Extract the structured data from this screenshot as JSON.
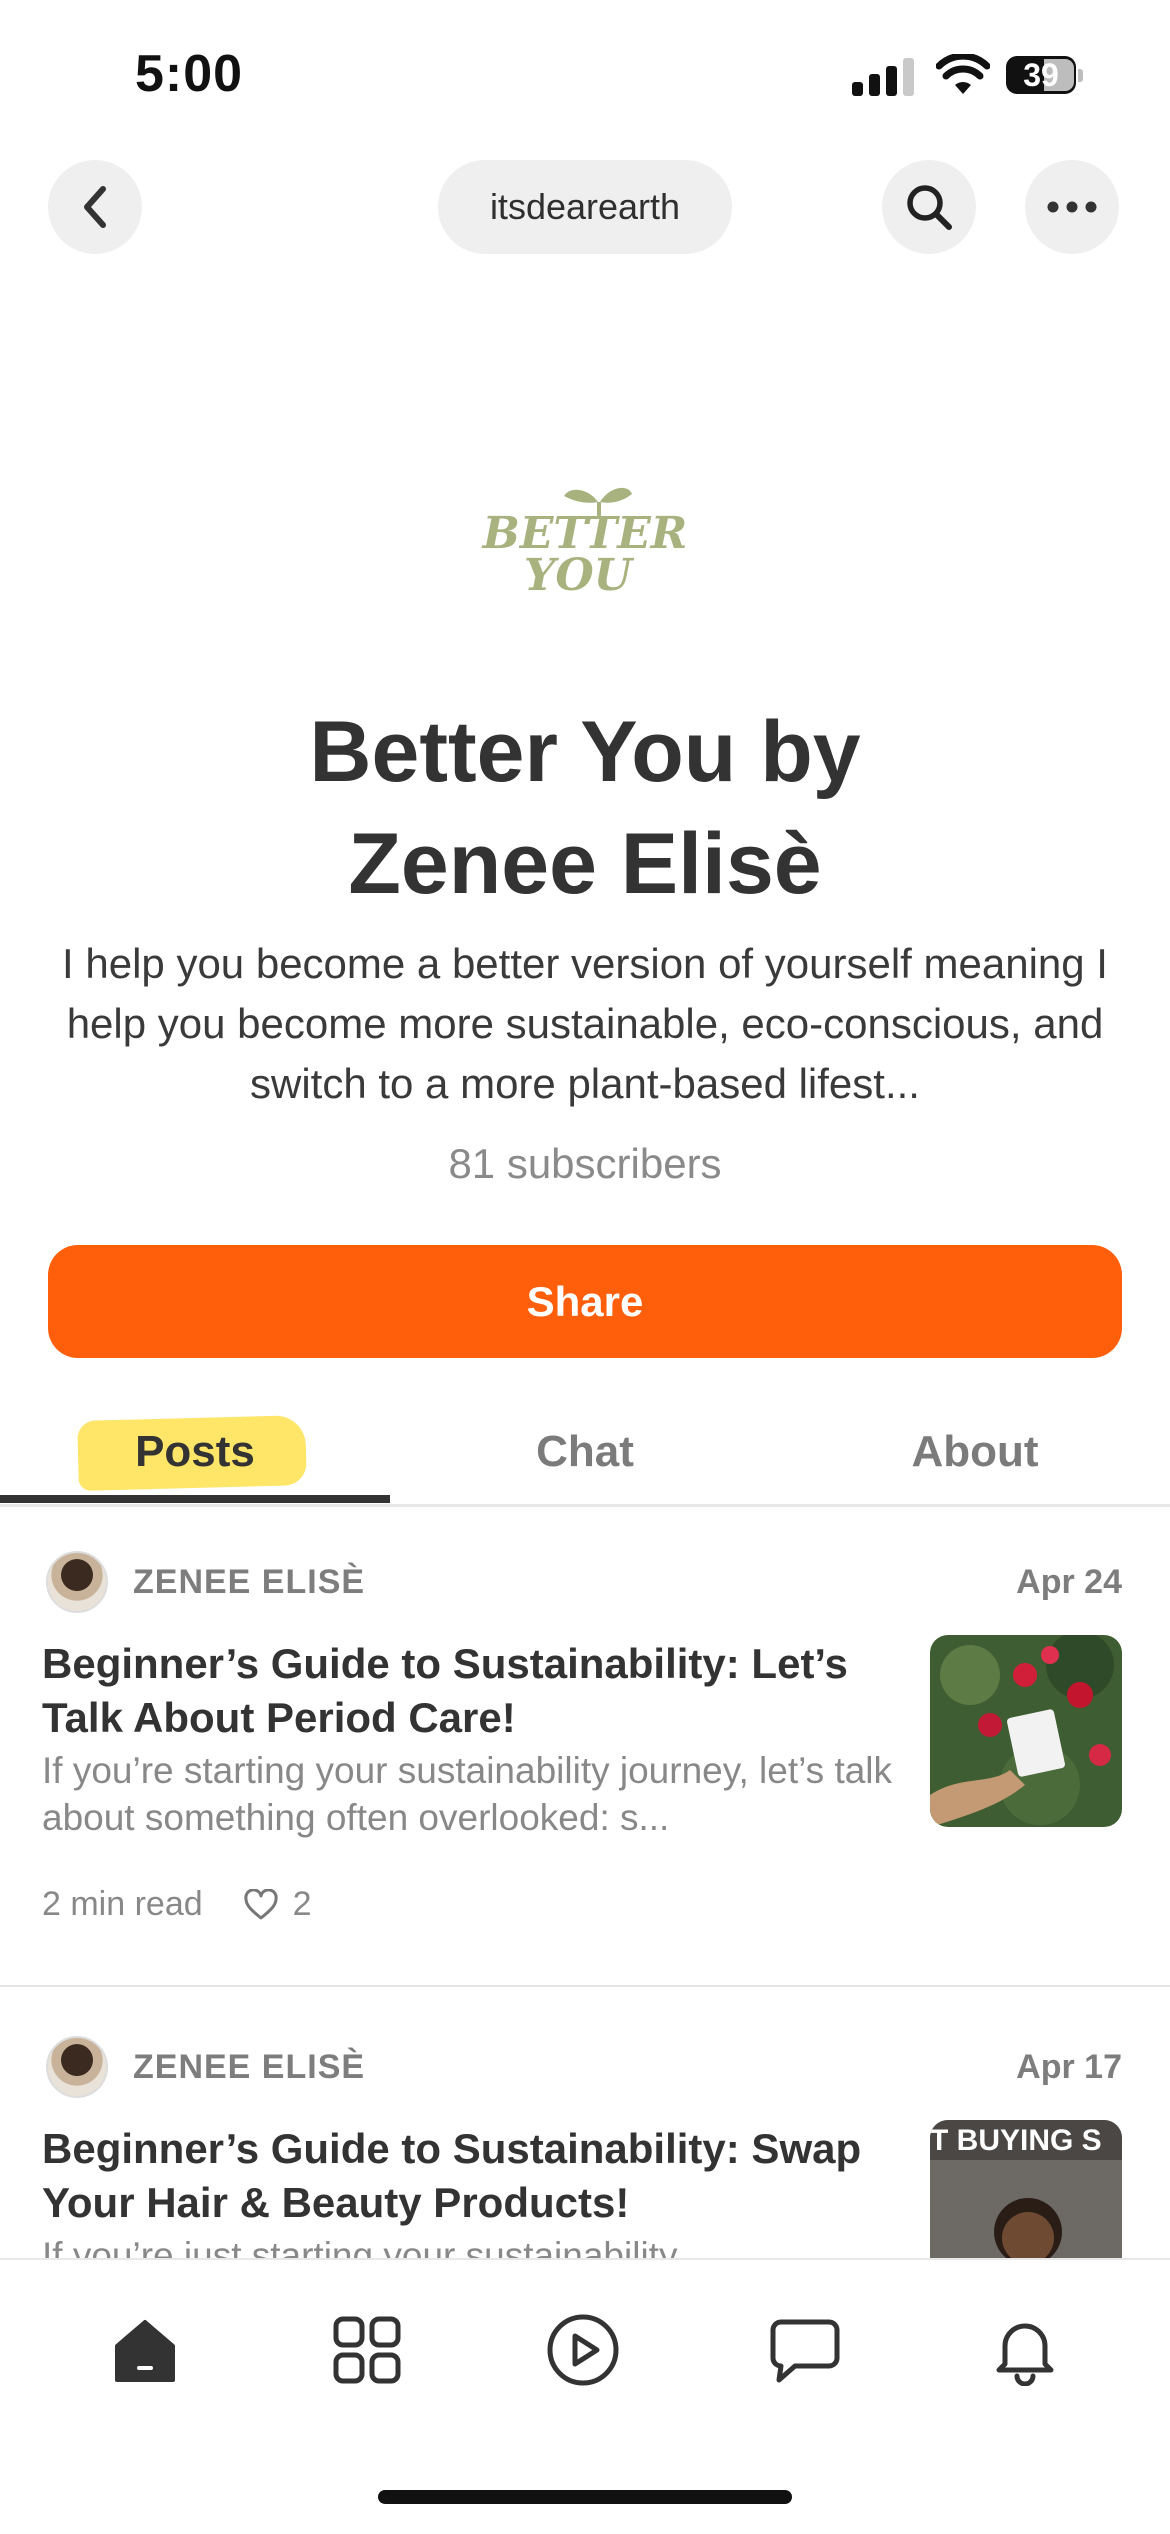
{
  "status_bar": {
    "time": "5:00",
    "battery": "39"
  },
  "nav": {
    "handle": "itsdearearth"
  },
  "publication": {
    "logo_text_line1": "BETTER",
    "logo_text_line2": "YOU",
    "title_line1": "Better You by",
    "title_line2": "Zenee Elisè",
    "description": "I help you become a better version of yourself meaning I help you become more sustainable, eco-conscious, and switch to a more plant-based lifest...",
    "subscribers": "81 subscribers",
    "share_label": "Share",
    "brand_color": "#ff5f0a",
    "logo_color": "#a7b27e"
  },
  "tabs": [
    {
      "label": "Posts",
      "active": true
    },
    {
      "label": "Chat",
      "active": false
    },
    {
      "label": "About",
      "active": false
    }
  ],
  "posts": [
    {
      "author": "ZENEE ELISÈ",
      "date": "Apr 24",
      "title": "Beginner’s Guide to Sustainability: Let’s Talk About Period Care!",
      "snippet": "If you’re starting your sustainability journey, let’s talk about something often overlooked: s...",
      "read_time": "2 min read",
      "likes": "2"
    },
    {
      "author": "ZENEE ELISÈ",
      "date": "Apr 17",
      "title": "Beginner’s Guide to Sustainability: Swap Your Hair & Beauty Products!",
      "snippet": "If you’re just starting your sustainability",
      "thumb_text": "T BUYING S"
    }
  ],
  "bottom_nav": [
    "home-icon",
    "grid-icon",
    "play-icon",
    "chat-icon",
    "bell-icon"
  ]
}
